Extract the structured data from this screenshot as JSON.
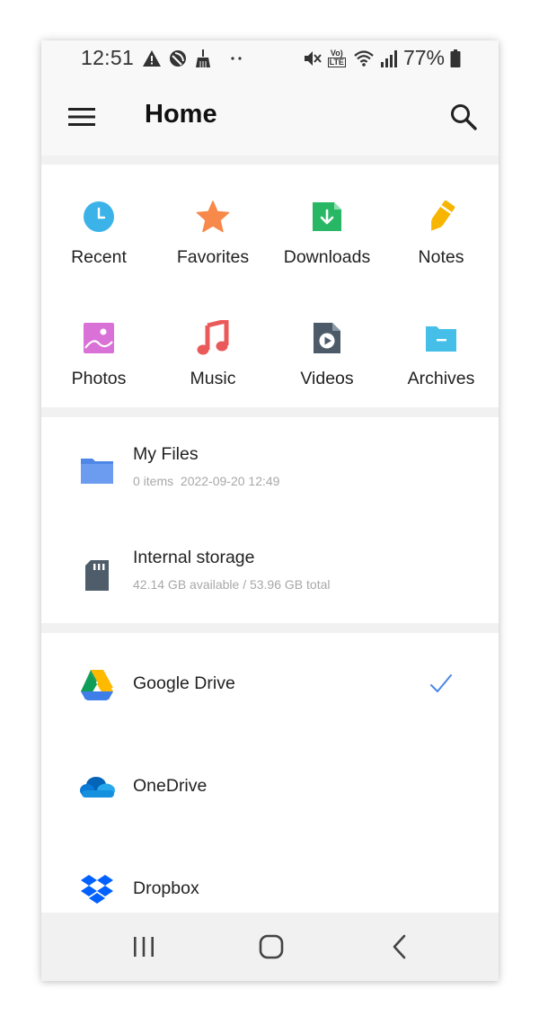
{
  "status_bar": {
    "time": "12:51",
    "battery_percent": "77%",
    "network_label_top": "Vo)",
    "network_label_bottom": "LTE",
    "left_icons": [
      "warning-icon",
      "blocked-icon",
      "broom-icon",
      "dots-icon"
    ],
    "right_icons": [
      "mute-vibrate-icon",
      "volte-icon",
      "wifi-icon",
      "signal-icon",
      "battery-icon"
    ]
  },
  "app_bar": {
    "title": "Home",
    "menu_icon": "hamburger-menu-icon",
    "search_icon": "search-icon"
  },
  "categories": [
    {
      "label": "Recent",
      "icon": "clock-icon",
      "color": "#3bb3e8"
    },
    {
      "label": "Favorites",
      "icon": "star-icon",
      "color": "#f7894a"
    },
    {
      "label": "Downloads",
      "icon": "download-icon",
      "color": "#28b765"
    },
    {
      "label": "Notes",
      "icon": "pencil-icon",
      "color": "#f7b500"
    },
    {
      "label": "Photos",
      "icon": "photo-icon",
      "color": "#d971d6"
    },
    {
      "label": "Music",
      "icon": "music-note-icon",
      "color": "#ea5a5a"
    },
    {
      "label": "Videos",
      "icon": "video-file-icon",
      "color": "#4d5b69"
    },
    {
      "label": "Archives",
      "icon": "archive-folder-icon",
      "color": "#45bfe8"
    }
  ],
  "storage": [
    {
      "title": "My Files",
      "subtitle": "0 items  2022-09-20 12:49",
      "icon": "folder-icon",
      "color": "#5b8def"
    },
    {
      "title": "Internal storage",
      "subtitle": "42.14 GB available / 53.96 GB total",
      "icon": "sd-card-icon",
      "color": "#4f5d6b"
    }
  ],
  "cloud": [
    {
      "title": "Google Drive",
      "icon": "google-drive-icon",
      "checked": true
    },
    {
      "title": "OneDrive",
      "icon": "onedrive-icon",
      "checked": false
    },
    {
      "title": "Dropbox",
      "icon": "dropbox-icon",
      "checked": false
    }
  ],
  "nav_bar": {
    "icons": [
      "recent-apps-icon",
      "home-icon",
      "back-icon"
    ]
  },
  "colors": {
    "check": "#4a86e8",
    "background": "#f1f1f1",
    "card": "#ffffff"
  }
}
